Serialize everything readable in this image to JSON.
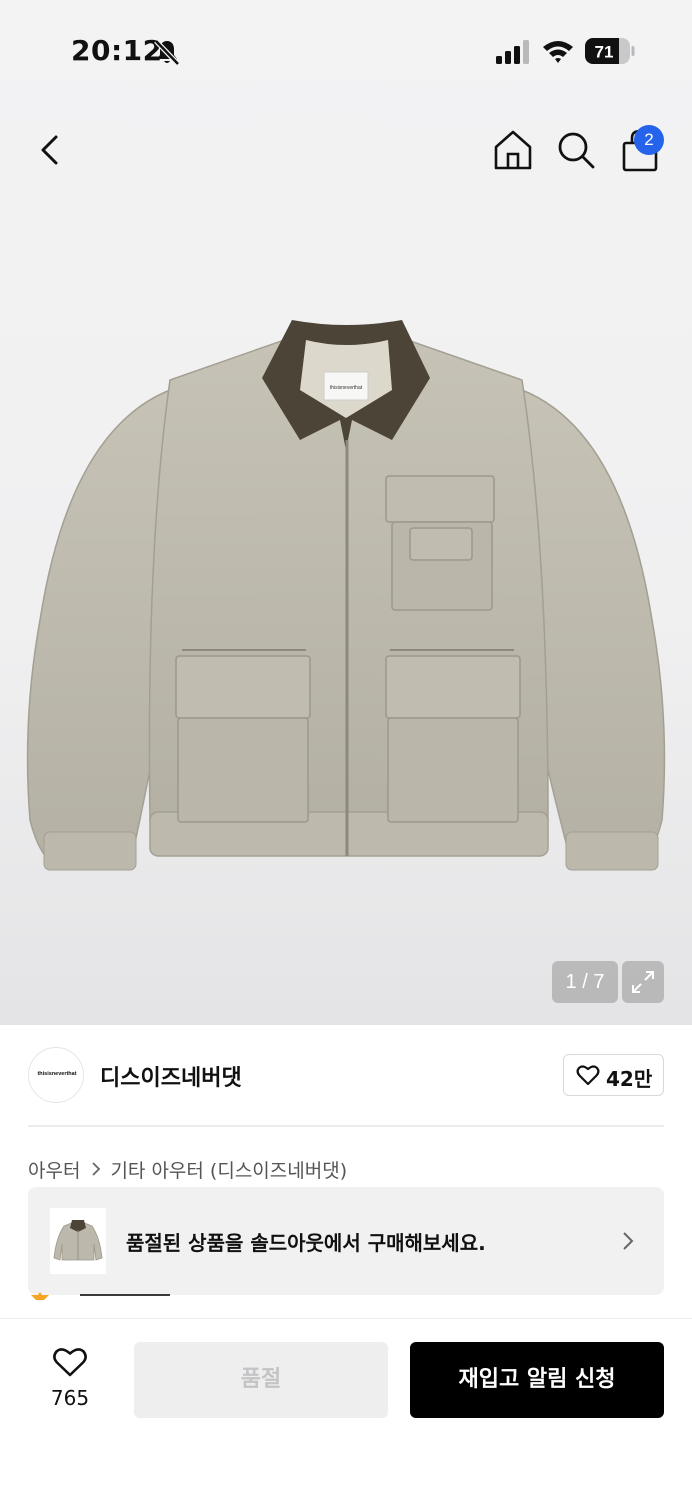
{
  "status_bar": {
    "time": "20:12",
    "battery": "71"
  },
  "nav": {
    "cart_count": "2"
  },
  "gallery": {
    "counter": "1 / 7",
    "image_label": "thisisneverthat"
  },
  "brand": {
    "logo_text": "thisisneverthat",
    "name": "디스이즈네버댓",
    "like_count": "42만"
  },
  "breadcrumb": {
    "items": [
      "아우터",
      "기타 아우터 (디스이즈네버댓)"
    ]
  },
  "soldout_banner": {
    "text": "품절된 상품을 솔드아웃에서 구매해보세요."
  },
  "bottom_bar": {
    "wish_count": "765",
    "soldout_label": "품절",
    "restock_label": "재입고 알림 신청"
  },
  "colors": {
    "badge": "#2563eb",
    "primary_button": "#000000",
    "disabled_button": "#eeeeef",
    "banner_bg": "#f1f1f2"
  },
  "icons": [
    "bell-off-icon",
    "signal-icon",
    "wifi-icon",
    "battery-icon",
    "back-icon",
    "home-icon",
    "search-icon",
    "shopping-bag-icon",
    "expand-icon",
    "heart-icon",
    "chevron-right-icon"
  ]
}
